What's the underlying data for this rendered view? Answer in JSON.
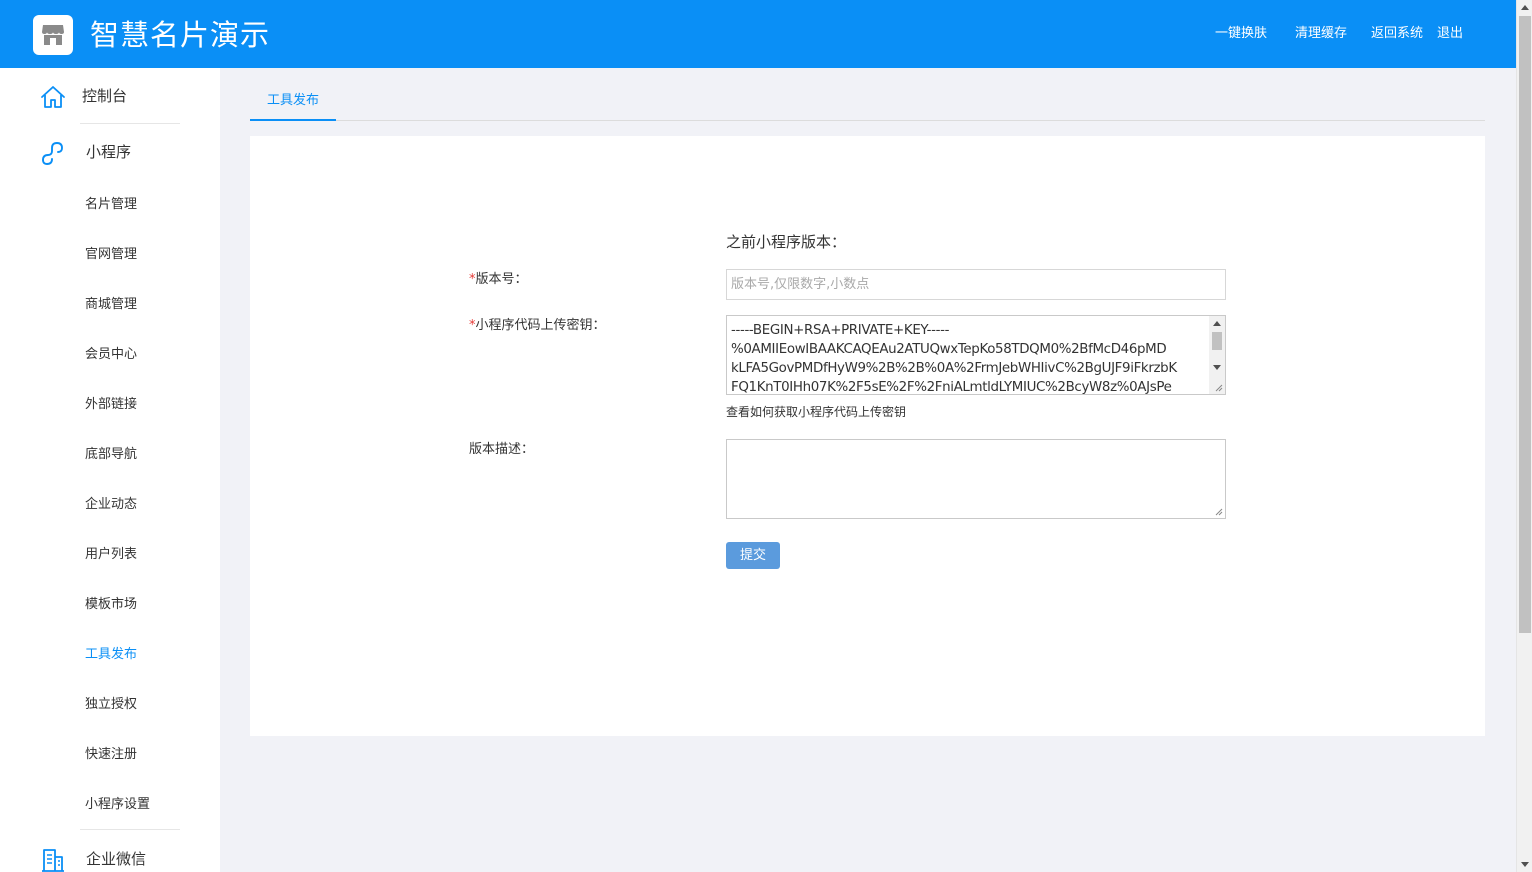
{
  "header": {
    "app_title": "智慧名片演示",
    "nav": [
      "一键换肤",
      "清理缓存",
      "返回系统",
      "退出"
    ]
  },
  "sidebar": {
    "top_items": [
      {
        "label": "控制台",
        "icon": "home-icon"
      },
      {
        "label": "小程序",
        "icon": "link-icon"
      },
      {
        "label": "企业微信",
        "icon": "building-icon"
      }
    ],
    "sub_items": [
      "名片管理",
      "官网管理",
      "商城管理",
      "会员中心",
      "外部链接",
      "底部导航",
      "企业动态",
      "用户列表",
      "模板市场",
      "工具发布",
      "独立授权",
      "快速注册",
      "小程序设置"
    ],
    "active_item": "工具发布"
  },
  "tabs": [
    {
      "label": "工具发布"
    }
  ],
  "form": {
    "previous_version_label": "之前小程序版本：",
    "version_label": "版本号：",
    "version_value": "",
    "version_placeholder": "版本号,仅限数字,小数点",
    "key_label": "小程序代码上传密钥：",
    "key_value": "-----BEGIN+RSA+PRIVATE+KEY-----\n%0AMIIEowIBAAKCAQEAu2ATUQwxTepKo58TDQM0%2BfMcD46pMD\nkLFA5GovPMDfHyW9%2B%2B%0A%2FrmJebWHIivC%2BgUJF9iFkrzbK\nFQ1KnT0IHh07K%2F5sE%2F%2FniALmtldLYMIUC%2BcyW8z%0AJsPe",
    "key_help_link": "查看如何获取小程序代码上传密钥",
    "description_label": "版本描述：",
    "description_value": "",
    "required_mark": "*",
    "submit_label": "提交"
  },
  "colors": {
    "header_bg": "#0a8ff6",
    "accent": "#0a8ff6",
    "submit_bg": "#5b9bdd",
    "required": "#e53935",
    "page_bg": "#f1f2f7"
  }
}
